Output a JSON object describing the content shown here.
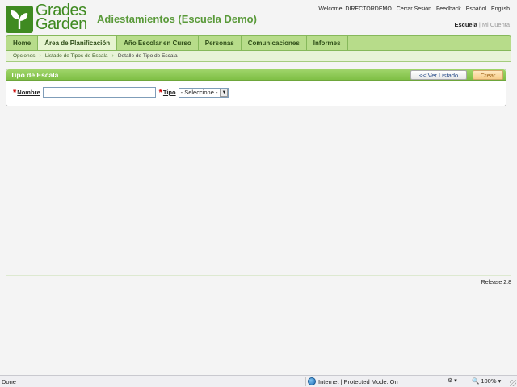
{
  "header": {
    "logo_line1": "Grades",
    "logo_line2": "Garden",
    "school_title": "Adiestamientos (Escuela Demo)",
    "toplinks": {
      "welcome": "Welcome: DIRECTORDEMO",
      "logout": "Cerrar Sesión",
      "feedback": "Feedback",
      "lang_es": "Español",
      "lang_en": "English"
    },
    "account": {
      "school": "Escuela",
      "sep": "|",
      "my_account": "Mi Cuenta"
    }
  },
  "nav": {
    "items": [
      {
        "label": "Home"
      },
      {
        "label": "Área de Planificación"
      },
      {
        "label": "Año Escolar en Curso"
      },
      {
        "label": "Personas"
      },
      {
        "label": "Comunicaciones"
      },
      {
        "label": "Informes"
      }
    ],
    "active_index": 1
  },
  "breadcrumb": {
    "items": [
      "Opciones",
      "Listado de Tipos de Escala",
      "Detalle de Tipo de Escala"
    ]
  },
  "panel": {
    "title": "Tipo de Escala",
    "list_button": "<< Ver Listado",
    "create_button": "Crear",
    "fields": {
      "nombre_label": "Nombre",
      "nombre_value": "",
      "tipo_label": "Tipo",
      "tipo_selected": "- Seleccione -",
      "required_mark": "*"
    }
  },
  "footer": {
    "release": "Release 2.8"
  },
  "statusbar": {
    "done": "Done",
    "zone": "Internet | Protected Mode: On",
    "zoom": "100%"
  },
  "colors": {
    "brand_green": "#3f8a21",
    "nav_bg": "#b7dc8a",
    "panel_head": "#7fbf45",
    "required": "#cc0000"
  }
}
